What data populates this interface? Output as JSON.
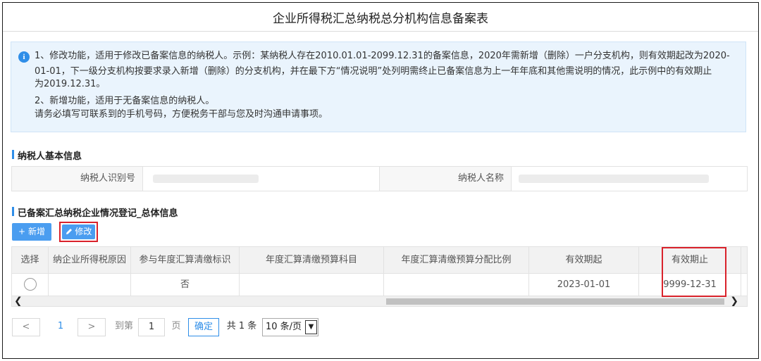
{
  "page": {
    "title": "企业所得税汇总纳税总分机构信息备案表"
  },
  "notice": {
    "lines": [
      "1、修改功能，适用于修改已备案信息的纳税人。示例：某纳税人存在2010.01.01-2099.12.31的备案信息，2020年需新增（删除）一户分支机构，则有效期起改为2020-",
      "01-01，下一级分支机构按要求录入新增（删除）的分支机构，并在最下方“情况说明”处列明需终止已备案信息为上一年年底和其他需说明的情况，此示例中的有效期止",
      "为2019.12.31。",
      "2、新增功能，适用于无备案信息的纳税人。",
      "请务必填写可联系到的手机号码，方便税务干部与您及时沟通申请事项。"
    ]
  },
  "basic_info": {
    "section_title": "纳税人基本信息",
    "taxpayer_id_label": "纳税人识别号",
    "taxpayer_id_value": "",
    "taxpayer_name_label": "纳税人名称",
    "taxpayer_name_value": ""
  },
  "records": {
    "section_title": "已备案汇总纳税企业情况登记_总体信息",
    "add_label": "新增",
    "edit_label": "修改",
    "columns": [
      "选择",
      "纳企业所得税原因",
      "参与年度汇算清缴标识",
      "年度汇算清缴预算科目",
      "年度汇算清缴预算分配比例",
      "有效期起",
      "有效期止"
    ],
    "rows": [
      {
        "reason": "",
        "participate": "否",
        "budget_subject": "",
        "ratio": "",
        "start": "2023-01-01",
        "end": "9999-12-31"
      }
    ]
  },
  "pagination": {
    "prev": "<",
    "current_page": "1",
    "next": ">",
    "goto_label": "到第",
    "page_input": "1",
    "page_unit": "页",
    "confirm": "确定",
    "total": "共 1 条",
    "page_size": "10 条/页"
  },
  "colors": {
    "accent": "#4a9df0",
    "highlight": "#d9222b",
    "notice_bg": "#eaf4fd"
  }
}
